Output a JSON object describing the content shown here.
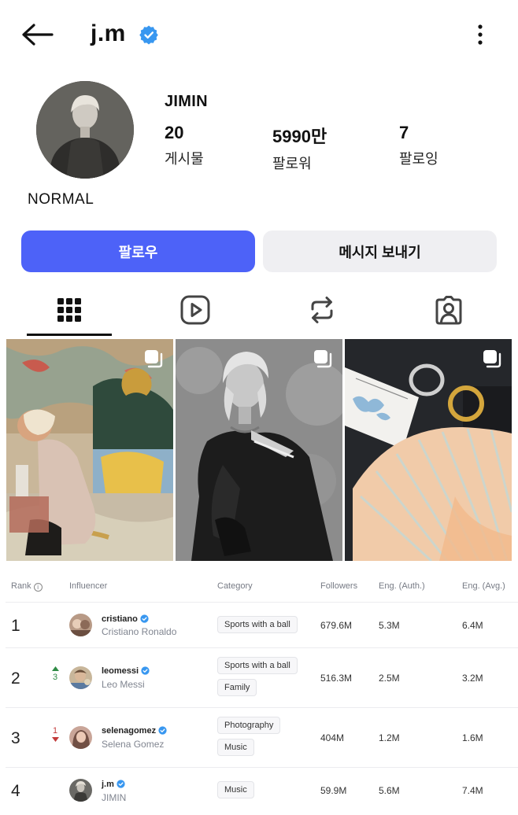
{
  "header": {
    "handle": "j.m",
    "back_icon": "arrow-left-icon",
    "verified_icon": "verified-badge-icon",
    "menu_icon": "more-vertical-icon"
  },
  "profile": {
    "display_name": "JIMIN",
    "bio": "NORMAL",
    "stats": {
      "posts": {
        "value": "20",
        "label": "게시물"
      },
      "followers": {
        "value": "5990만",
        "label": "팔로워"
      },
      "following": {
        "value": "7",
        "label": "팔로잉"
      }
    }
  },
  "actions": {
    "follow_label": "팔로우",
    "message_label": "메시지 보내기",
    "follow_color": "#4d62f8"
  },
  "tabs": [
    {
      "icon": "grid-icon",
      "active": true
    },
    {
      "icon": "reels-play-icon",
      "active": false
    },
    {
      "icon": "repost-icon",
      "active": false
    },
    {
      "icon": "tagged-person-icon",
      "active": false
    }
  ],
  "posts": [
    {
      "icon": "multiple-photos-icon"
    },
    {
      "icon": "multiple-photos-icon"
    },
    {
      "icon": "multiple-photos-icon"
    }
  ],
  "ranking": {
    "columns": {
      "rank": "Rank",
      "influencer": "Influencer",
      "category": "Category",
      "followers": "Followers",
      "eng_auth": "Eng. (Auth.)",
      "eng_avg": "Eng. (Avg.)"
    },
    "rows": [
      {
        "rank": "1",
        "trend": null,
        "trend_value": "",
        "username": "cristiano",
        "name": "Cristiano Ronaldo",
        "categories": [
          "Sports with a ball"
        ],
        "followers": "679.6M",
        "eng_auth": "5.3M",
        "eng_avg": "6.4M"
      },
      {
        "rank": "2",
        "trend": "up",
        "trend_value": "3",
        "username": "leomessi",
        "name": "Leo Messi",
        "categories": [
          "Sports with a ball",
          "Family"
        ],
        "followers": "516.3M",
        "eng_auth": "2.5M",
        "eng_avg": "3.2M"
      },
      {
        "rank": "3",
        "trend": "down",
        "trend_value": "1",
        "username": "selenagomez",
        "name": "Selena Gomez",
        "categories": [
          "Photography",
          "Music"
        ],
        "followers": "404M",
        "eng_auth": "1.2M",
        "eng_avg": "1.6M"
      },
      {
        "rank": "4",
        "trend": null,
        "trend_value": "",
        "username": "j.m",
        "name": "JIMIN",
        "categories": [
          "Music"
        ],
        "followers": "59.9M",
        "eng_auth": "5.6M",
        "eng_avg": "7.4M"
      }
    ],
    "colors": {
      "up": "#2e8b45",
      "down": "#c23a3a",
      "verified": "#3897f0"
    }
  }
}
